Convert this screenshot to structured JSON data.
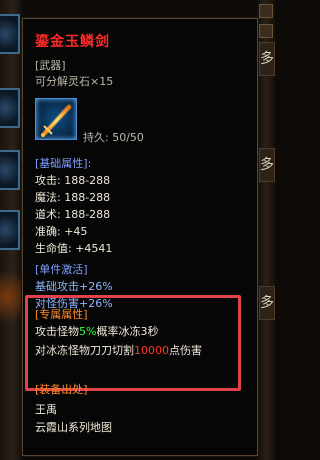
{
  "item": {
    "name": "鎏金玉鳞剑",
    "type": "[武器]",
    "decompose": "可分解灵石×15",
    "durability": "持久: 50/50"
  },
  "base": {
    "header": "[基础属性]:",
    "attack": "攻击: 188-288",
    "magic": "魔法: 188-288",
    "tao": "道术: 188-288",
    "accuracy": "准确: +45",
    "hp": "生命值: +4541"
  },
  "single": {
    "header": "[单件激活]",
    "line1": "基础攻击+26%",
    "line2": "对怪伤害+26%"
  },
  "exclusive": {
    "header": "[专属属性]",
    "line1_pre": "攻击怪物",
    "line1_pct": "5%",
    "line1_post": "概率冰冻3秒",
    "line2_pre": "对冰冻怪物刀刀切割",
    "line2_num": "10000",
    "line2_post": "点伤害"
  },
  "source": {
    "header": "[装备出处]",
    "line1": "王禹",
    "line2": "云霞山系列地图"
  },
  "right_tab_char": "多",
  "colors": {
    "title": "#ff2a2a",
    "highlight_border": "#e2424a"
  }
}
